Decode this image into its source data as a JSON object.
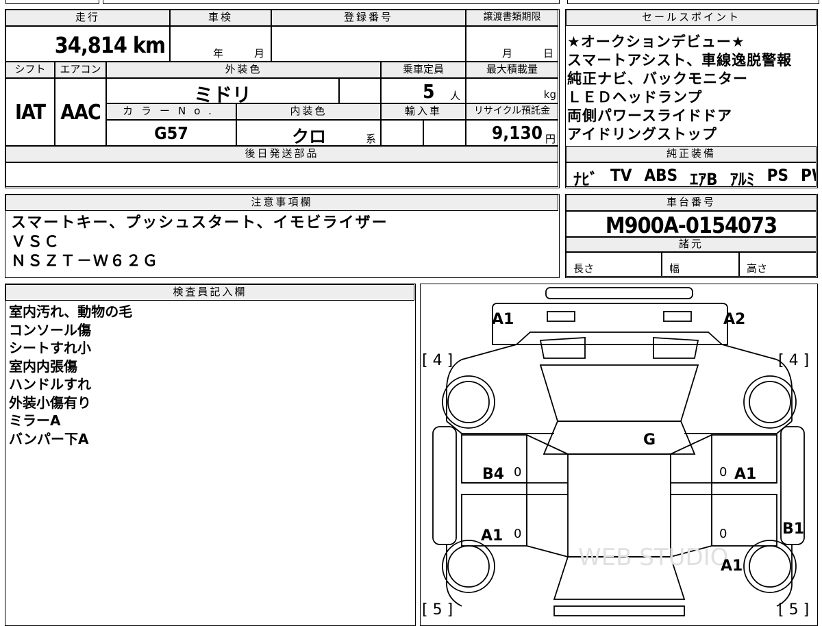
{
  "sheet": {
    "mileage_label": "走行",
    "mileage_value": "34,814",
    "mileage_unit": "km",
    "inspection_label": "車検",
    "year_label": "年",
    "month_label": "月",
    "registration_label": "登録番号",
    "transfer_label": "譲渡書類期限",
    "transfer_month": "月",
    "transfer_day": "日",
    "shift_label": "シフト",
    "shift_value": "IAT",
    "aircon_label": "エアコン",
    "aircon_value": "AAC",
    "exterior_label": "外装色",
    "exterior_value": "ミドリ",
    "capacity_label": "乗車定員",
    "capacity_value": "5",
    "capacity_unit": "人",
    "load_label": "最大積載量",
    "load_unit": "kg",
    "color_no_label": "カラーNo.",
    "color_no_value": "G57",
    "interior_label": "内装色",
    "interior_value": "クロ",
    "interior_suffix": "系",
    "import_label": "輸入車",
    "recycle_label": "リサイクル預託金",
    "recycle_value": "9,130",
    "recycle_unit": "円",
    "later_parts_label": "後日発送部品"
  },
  "sales": {
    "label": "セールスポイント",
    "lines": [
      "★オークションデビュー★",
      "スマートアシスト、車線逸脱警報",
      "純正ナビ、バックモニター",
      "ＬＥＤヘッドランプ",
      "両側パワースライドドア",
      "アイドリングストップ"
    ]
  },
  "equipment": {
    "label": "純正装備",
    "items": [
      "ﾅﾋﾞ",
      "TV",
      "ABS",
      "ｴｱB",
      "ｱﾙﾐ",
      "PS",
      "PW"
    ]
  },
  "notes": {
    "label": "注意事項欄",
    "lines": [
      "スマートキー、プッシュスタート、イモビライザー",
      "ＶＳＣ",
      "ＮＳＺＴ－Ｗ６２Ｇ"
    ]
  },
  "chassis": {
    "label": "車台番号",
    "value": "M900A-0154073",
    "spec_label": "諸元",
    "length_label": "長さ",
    "width_label": "幅",
    "height_label": "高さ"
  },
  "inspector": {
    "label": "検査員記入欄",
    "lines": [
      "室内汚れ、動物の毛",
      "コンソール傷",
      "シートすれ小",
      "室内内張傷",
      "ハンドルすれ",
      "外装小傷有り",
      "ミラーA",
      "バンパー下A"
    ]
  },
  "diagram": {
    "front_left": "A1",
    "front_right": "A2",
    "tire_front_left": "[ 4 ]",
    "tire_front_right": "[ 4 ]",
    "tire_rear_left": "[ 5 ]",
    "tire_rear_right": "[ 5 ]",
    "glass": "G",
    "left_front_door": "B4",
    "left_rear_door": "A1",
    "right_front_door": "A1",
    "right_pillar": "B1",
    "right_rear": "A1",
    "slot_mark": "0",
    "watermark": "WEB STUDIO"
  }
}
